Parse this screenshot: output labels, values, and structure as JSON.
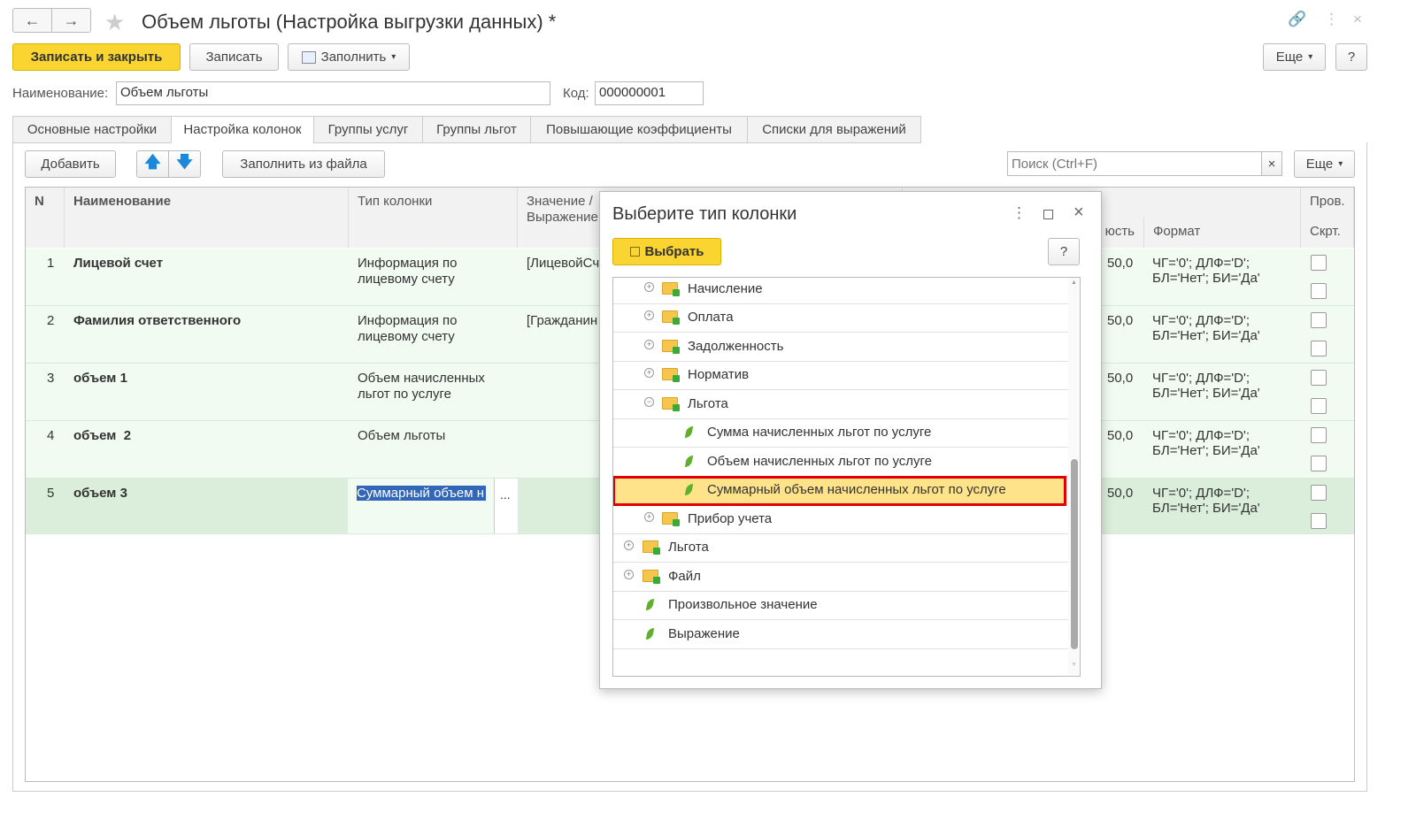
{
  "window": {
    "title": "Объем льготы (Настройка выгрузки данных) *"
  },
  "toolbar": {
    "save_close": "Записать и закрыть",
    "save": "Записать",
    "fill": "Заполнить",
    "more": "Еще",
    "help": "?"
  },
  "form": {
    "name_label": "Наименование:",
    "name_value": "Объем льготы",
    "code_label": "Код:",
    "code_value": "000000001"
  },
  "tabs": [
    "Основные настройки",
    "Настройка колонок",
    "Группы услуг",
    "Группы льгот",
    "Повышающие коэффициенты",
    "Списки для выражений"
  ],
  "table_toolbar": {
    "add": "Добавить",
    "fill_from_file": "Заполнить из файла",
    "search_placeholder": "Поиск (Ctrl+F)",
    "clear": "×",
    "more": "Еще"
  },
  "table": {
    "headers": {
      "n": "N",
      "name": "Наименование",
      "type": "Тип колонки",
      "value": "Значение /\nВыражение",
      "length": "юсть",
      "format": "Формат",
      "check": "Пров.",
      "hide": "Скрт."
    },
    "rows": [
      {
        "n": "1",
        "name": "Лицевой счет",
        "type": "Информация по\nлицевому счету",
        "value": "[ЛицевойСч",
        "length": "50,0",
        "format": "ЧГ='0'; ДЛФ='D';\nБЛ='Нет'; БИ='Да'"
      },
      {
        "n": "2",
        "name": "Фамилия ответственного",
        "type": "Информация по\nлицевому счету",
        "value": "[Гражданин",
        "length": "50,0",
        "format": "ЧГ='0'; ДЛФ='D';\nБЛ='Нет'; БИ='Да'"
      },
      {
        "n": "3",
        "name": "объем 1",
        "type": "Объем начисленных\nльгот по услуге",
        "value": "",
        "length": "50,0",
        "format": "ЧГ='0'; ДЛФ='D';\nБЛ='Нет'; БИ='Да'"
      },
      {
        "n": "4",
        "name": "объем  2",
        "type": "Объем льготы",
        "value": "",
        "length": "50,0",
        "format": "ЧГ='0'; ДЛФ='D';\nБЛ='Нет'; БИ='Да'"
      },
      {
        "n": "5",
        "name": "объем 3",
        "type": "Суммарный объем н",
        "value": "",
        "length": "50,0",
        "format": "ЧГ='0'; ДЛФ='D';\nБЛ='Нет'; БИ='Да'"
      }
    ],
    "edit_button": "..."
  },
  "dialog": {
    "title": "Выберите тип колонки",
    "select": "Выбрать",
    "help": "?",
    "items": [
      {
        "label": "Начисление",
        "kind": "folder",
        "expanded": false
      },
      {
        "label": "Оплата",
        "kind": "folder",
        "expanded": false
      },
      {
        "label": "Задолженность",
        "kind": "folder",
        "expanded": false
      },
      {
        "label": "Норматив",
        "kind": "folder",
        "expanded": false
      },
      {
        "label": "Льгота",
        "kind": "folder",
        "expanded": true
      },
      {
        "label": "Сумма начисленных льгот по услуге",
        "kind": "leaf"
      },
      {
        "label": "Объем начисленных льгот по услуге",
        "kind": "leaf"
      },
      {
        "label": "Суммарный объем начисленных льгот по услуге",
        "kind": "leaf",
        "selected": true
      },
      {
        "label": "Прибор учета",
        "kind": "folder",
        "expanded": false
      },
      {
        "label": "Льгота",
        "kind": "folder",
        "expanded": false
      },
      {
        "label": "Файл",
        "kind": "folder",
        "expanded": false
      },
      {
        "label": "Произвольное значение",
        "kind": "leaf"
      },
      {
        "label": "Выражение",
        "kind": "leaf"
      }
    ]
  },
  "colors": {
    "accent": "#fad532",
    "row_bg": "#f1fbf1",
    "selected_border": "#e00000",
    "selection_bg": "#ffe38a"
  }
}
